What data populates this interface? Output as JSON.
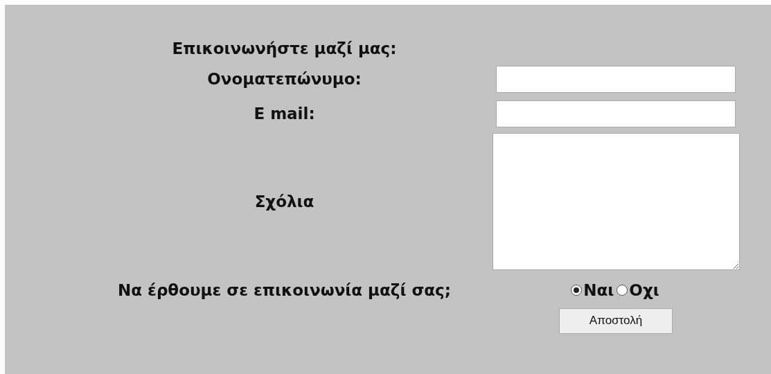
{
  "heading": "Επικοινωνήστε μαζί μας:",
  "fields": [
    {
      "kind": "input",
      "label": "Ονοματεπώνυμο:"
    },
    {
      "kind": "input",
      "label": "E mail:"
    },
    {
      "kind": "textarea",
      "label": "Σχόλια"
    }
  ],
  "contact_question": {
    "label": "Να έρθουμε σε επικοινωνία μαζί σας;",
    "options": [
      {
        "label": "Ναι",
        "selected": true
      },
      {
        "label": "Οχι",
        "selected": false
      }
    ]
  },
  "submit_button": "Αποστολή"
}
